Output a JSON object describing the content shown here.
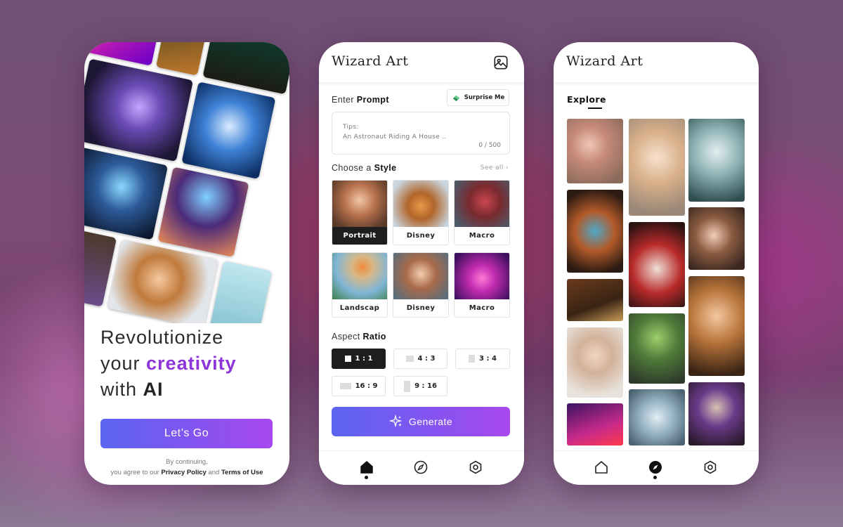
{
  "onboarding": {
    "hero_line1": "Revolutionize",
    "hero_line2_prefix": "your ",
    "hero_line2_accent": "creativity",
    "hero_line3_prefix": "with ",
    "hero_line3_bold": "AI",
    "cta_label": "Let’s Go",
    "terms_line1": "By continuing,",
    "terms_prefix": "you agree to our ",
    "privacy_label": "Privacy Policy",
    "terms_and": " and ",
    "terms_label": "Terms of Use"
  },
  "create": {
    "app_title": "Wizard Art",
    "prompt_label_prefix": "Enter ",
    "prompt_label_bold": "Prompt",
    "surprise_label": "Surprise Me",
    "tips_label": "Tips:",
    "tips_text": "An Astronaut Riding A House ..",
    "counter": "0 / 500",
    "style_label_prefix": "Choose a ",
    "style_label_bold": "Style",
    "see_all": "See all",
    "styles": [
      {
        "label": "Portrait",
        "selected": true
      },
      {
        "label": "Disney"
      },
      {
        "label": "Macro"
      },
      {
        "label": "Landscap"
      },
      {
        "label": "Disney"
      },
      {
        "label": "Macro"
      }
    ],
    "ratio_label_prefix": "Aspect ",
    "ratio_label_bold": "Ratio",
    "ratios": [
      "1 : 1",
      "4 : 3",
      "3 : 4",
      "16 : 9",
      "9 : 16"
    ],
    "selected_ratio": "1 : 1",
    "generate_label": "Generate"
  },
  "explore": {
    "app_title": "Wizard Art",
    "tab_label": "Explore"
  },
  "colors": {
    "accent_purple": "#8d35d8",
    "gradient_start": "#5a65f0",
    "gradient_end": "#a747f0",
    "selected_dark": "#1e1e1e"
  },
  "icons": {
    "header": "gallery-icon",
    "tabs": [
      "home-icon",
      "compass-icon",
      "settings-icon"
    ]
  }
}
